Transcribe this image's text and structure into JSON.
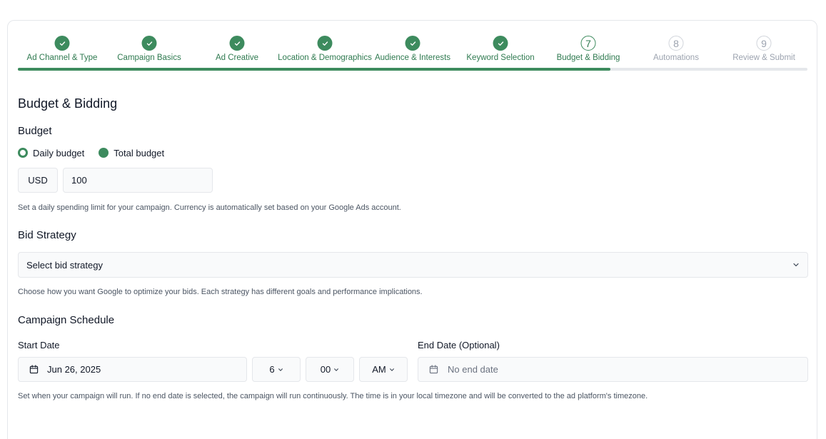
{
  "stepper": {
    "steps": [
      {
        "label": "Ad Channel & Type",
        "status": "done"
      },
      {
        "label": "Campaign Basics",
        "status": "done"
      },
      {
        "label": "Ad Creative",
        "status": "done"
      },
      {
        "label": "Location & Demographics",
        "status": "done"
      },
      {
        "label": "Audience & Interests",
        "status": "done"
      },
      {
        "label": "Keyword Selection",
        "status": "done"
      },
      {
        "label": "Budget & Bidding",
        "status": "active",
        "number": "7"
      },
      {
        "label": "Automations",
        "status": "todo",
        "number": "8"
      },
      {
        "label": "Review & Submit",
        "status": "todo",
        "number": "9"
      }
    ],
    "progress_fraction": 0.75
  },
  "page_title": "Budget & Bidding",
  "budget": {
    "heading": "Budget",
    "options": [
      "Daily budget",
      "Total budget"
    ],
    "currency": "USD",
    "amount": "100",
    "help": "Set a daily spending limit for your campaign. Currency is automatically set based on your Google Ads account."
  },
  "bid_strategy": {
    "heading": "Bid Strategy",
    "placeholder": "Select bid strategy",
    "help": "Choose how you want Google to optimize your bids. Each strategy has different goals and performance implications."
  },
  "schedule": {
    "heading": "Campaign Schedule",
    "start_label": "Start Date",
    "start_date": "Jun 26, 2025",
    "hour": "6",
    "minute": "00",
    "ampm": "AM",
    "end_label": "End Date (Optional)",
    "end_placeholder": "No end date",
    "help": "Set when your campaign will run. If no end date is selected, the campaign will run continuously. The time is in your local timezone and will be converted to the ad platform's timezone."
  },
  "colors": {
    "accent": "#3d8b5e",
    "accent_text": "#2f7a50",
    "muted": "#9ca3af",
    "border": "#e5e7eb",
    "field_bg": "#f9fafb"
  },
  "icons": [
    "check-icon",
    "calendar-icon",
    "chevron-down-icon"
  ]
}
